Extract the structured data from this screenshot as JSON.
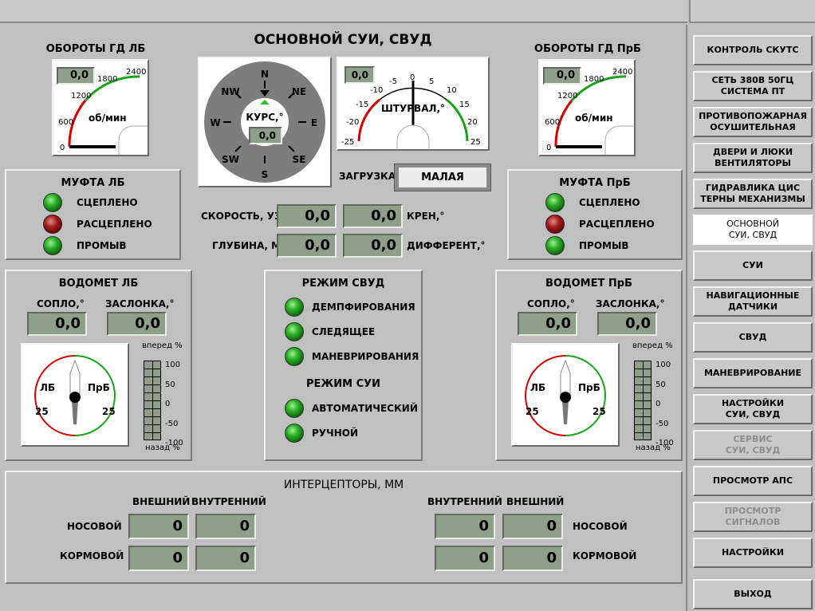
{
  "header": {
    "title": "ОСНОВНОЙ СУИ, СВУД"
  },
  "rpm_left": {
    "title": "ОБОРОТЫ ГД ЛБ",
    "value": "0,0",
    "unit": "об/мин",
    "ticks": [
      "0",
      "600",
      "1200",
      "1800",
      "2400"
    ]
  },
  "rpm_right": {
    "title": "ОБОРОТЫ ГД ПрБ",
    "value": "0,0",
    "unit": "об/мин",
    "ticks": [
      "0",
      "600",
      "1200",
      "1800",
      "2400"
    ]
  },
  "compass": {
    "label": "КУРС,°",
    "value": "0,0",
    "dirs": [
      "N",
      "NE",
      "E",
      "SE",
      "S",
      "SW",
      "W",
      "NW"
    ]
  },
  "helm": {
    "label": "ШТУРВАЛ,°",
    "value": "0,0",
    "ticks": [
      "-25",
      "-20",
      "-15",
      "-10",
      "-5",
      "0",
      "5",
      "10",
      "15",
      "20",
      "25"
    ]
  },
  "load": {
    "label": "ЗАГРУЗКА",
    "value": "МАЛАЯ"
  },
  "clutch_left": {
    "title": "МУФТА ЛБ",
    "items": [
      {
        "label": "СЦЕПЛЕНО",
        "state": "green"
      },
      {
        "label": "РАСЦЕПЛЕНО",
        "state": "red"
      },
      {
        "label": "ПРОМЫВ",
        "state": "green"
      }
    ]
  },
  "clutch_right": {
    "title": "МУФТА ПрБ",
    "items": [
      {
        "label": "СЦЕПЛЕНО",
        "state": "green"
      },
      {
        "label": "РАСЦЕПЛЕНО",
        "state": "red"
      },
      {
        "label": "ПРОМЫВ",
        "state": "green"
      }
    ]
  },
  "nav": {
    "speed_label": "СКОРОСТЬ, УЗ",
    "speed": "0,0",
    "roll_label": "КРЕН,°",
    "roll": "0,0",
    "depth_label": "ГЛУБИНА, М",
    "depth": "0,0",
    "trim_label": "ДИФФЕРЕНТ,°",
    "trim": "0,0"
  },
  "jet_left": {
    "title": "ВОДОМЕТ ЛБ",
    "nozzle_label": "СОПЛО,°",
    "nozzle": "0,0",
    "flap_label": "ЗАСЛОНКА,°",
    "flap": "0,0",
    "lb": "ЛБ",
    "prb": "ПрБ",
    "left25": "25",
    "right25": "25",
    "fwd": "вперед %",
    "back": "назад %",
    "scale": [
      "100",
      "50",
      "0",
      "-50",
      "-100"
    ]
  },
  "jet_right": {
    "title": "ВОДОМЕТ ПрБ",
    "nozzle_label": "СОПЛО,°",
    "nozzle": "0,0",
    "flap_label": "ЗАСЛОНКА,°",
    "flap": "0,0",
    "lb": "ЛБ",
    "prb": "ПрБ",
    "left25": "25",
    "right25": "25",
    "fwd": "вперед %",
    "back": "назад %",
    "scale": [
      "100",
      "50",
      "0",
      "-50",
      "-100"
    ]
  },
  "mode_svud": {
    "title": "РЕЖИМ СВУД",
    "items": [
      "ДЕМПФИРОВАНИЯ",
      "СЛЕДЯЩЕЕ",
      "МАНЕВРИРОВАНИЯ"
    ]
  },
  "mode_sui": {
    "title": "РЕЖИМ СУИ",
    "items": [
      "АВТОМАТИЧЕСКИЙ",
      "РУЧНОЙ"
    ]
  },
  "interceptors": {
    "title": "ИНТЕРЦЕПТОРЫ, ММ",
    "outer": "ВНЕШНИЙ",
    "inner": "ВНУТРЕННИЙ",
    "bow": "НОСОВОЙ",
    "stern": "КОРМОВОЙ",
    "left": {
      "bow_outer": "0",
      "bow_inner": "0",
      "stern_outer": "0",
      "stern_inner": "0"
    },
    "right": {
      "bow_inner": "0",
      "bow_outer": "0",
      "stern_inner": "0",
      "stern_outer": "0"
    }
  },
  "sidebar": {
    "items": [
      {
        "label": "КОНТРОЛЬ СКУТС",
        "state": "normal"
      },
      {
        "label": "СЕТЬ 380В 50ГЦ\nСИСТЕМА ПТ",
        "state": "normal"
      },
      {
        "label": "ПРОТИВОПОЖАРНАЯ\nОСУШИТЕЛЬНАЯ",
        "state": "normal"
      },
      {
        "label": "ДВЕРИ И ЛЮКИ\nВЕНТИЛЯТОРЫ",
        "state": "normal"
      },
      {
        "label": "ГИДРАВЛИКА ЦИС\nТЕРНЫ МЕХАНИЗМЫ",
        "state": "normal"
      },
      {
        "label": "ОСНОВНОЙ\nСУИ, СВУД",
        "state": "active"
      },
      {
        "label": "СУИ",
        "state": "normal"
      },
      {
        "label": "НАВИГАЦИОННЫЕ\nДАТЧИКИ",
        "state": "normal"
      },
      {
        "label": "СВУД",
        "state": "normal"
      },
      {
        "label": "МАНЕВРИРОВАНИЕ",
        "state": "normal"
      },
      {
        "label": "НАСТРОЙКИ\nСУИ, СВУД",
        "state": "normal"
      },
      {
        "label": "СЕРВИС\nСУИ, СВУД",
        "state": "disabled"
      },
      {
        "label": "ПРОСМОТР АПС",
        "state": "normal"
      },
      {
        "label": "ПРОСМОТР\nСИГНАЛОВ",
        "state": "disabled"
      },
      {
        "label": "НАСТРОЙКИ",
        "state": "normal"
      },
      {
        "label": "ВЫХОД",
        "state": "normal"
      }
    ]
  }
}
